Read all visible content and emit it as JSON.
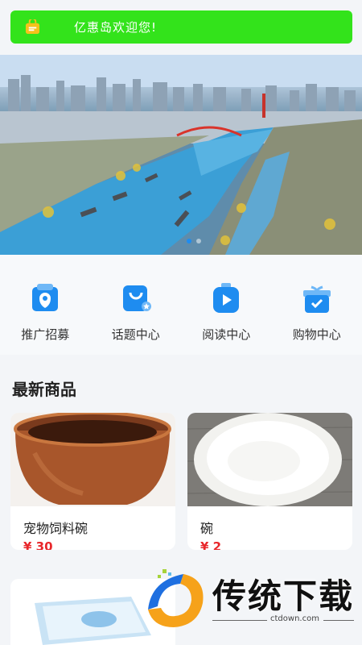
{
  "notice": {
    "text": "亿惠岛欢迎您!",
    "icon": "shop-bag-icon"
  },
  "banner": {
    "slides": 2,
    "active_slide": 1,
    "description_colors": {
      "active_dot": "#1e8cf0"
    }
  },
  "menu": {
    "items": [
      {
        "label": "推广招募",
        "icon": "promotion-icon"
      },
      {
        "label": "话题中心",
        "icon": "topic-bag-icon"
      },
      {
        "label": "阅读中心",
        "icon": "reading-play-icon"
      },
      {
        "label": "购物中心",
        "icon": "gift-box-icon"
      }
    ]
  },
  "section": {
    "title": "最新商品"
  },
  "products": [
    {
      "name": "宠物饲料碗",
      "price": "¥ 30"
    },
    {
      "name": "碗",
      "price": "¥ 2"
    },
    {
      "name": "",
      "price": ""
    }
  ],
  "watermark": {
    "brand": "传统下载",
    "url": "ctdown.com"
  },
  "colors": {
    "notice_bg": "#33e31b",
    "price": "#e8262a",
    "icon_blue": "#1e8cf0"
  }
}
